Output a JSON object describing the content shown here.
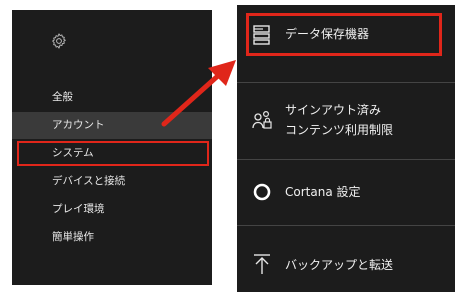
{
  "left_menu": {
    "items": [
      {
        "label": "全般"
      },
      {
        "label": "アカウント"
      },
      {
        "label": "システム"
      },
      {
        "label": "デバイスと接続"
      },
      {
        "label": "プレイ環境"
      },
      {
        "label": "簡単操作"
      }
    ],
    "active_index": 1,
    "highlight_index": 2
  },
  "right_menu": {
    "items": [
      {
        "icon": "storage-icon",
        "label": "データ保存機器"
      },
      {
        "icon": "users-lock-icon",
        "label_line1": "サインアウト済み",
        "label_line2": "コンテンツ利用制限"
      },
      {
        "icon": "cortana-circle-icon",
        "label": "Cortana 設定"
      },
      {
        "icon": "upload-arrow-icon",
        "label": "バックアップと転送"
      }
    ],
    "highlight_index": 0
  },
  "colors": {
    "panel_bg": "#1c1c1c",
    "highlight": "#e0261a",
    "active_row": "#3a3a3a",
    "text": "#f0f0f0"
  }
}
